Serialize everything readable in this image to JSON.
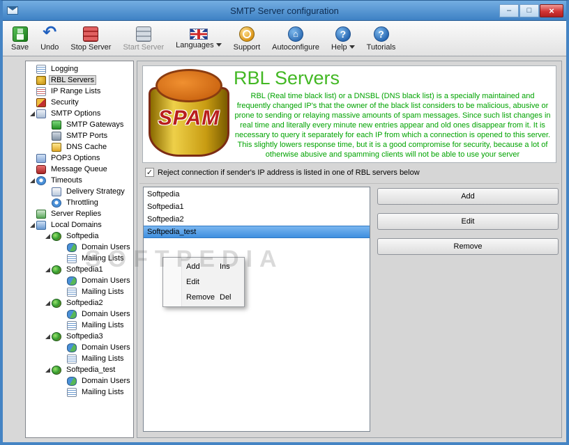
{
  "window": {
    "title": "SMTP Server configuration",
    "controls": {
      "minimize_glyph": "–",
      "maximize_glyph": "□",
      "close_glyph": "×"
    }
  },
  "colors": {
    "titlebar_top": "#74aee2",
    "titlebar_bottom": "#3e81c4",
    "window_border": "#4584c4",
    "close_button_red": "#d23535",
    "header_title_green": "#43b824",
    "description_green": "#00a300",
    "selection_blue": "#3f8fe0"
  },
  "toolbar": {
    "items": [
      {
        "name": "save",
        "label": "Save",
        "icon": "save-icon",
        "enabled": true,
        "dropdown": false
      },
      {
        "name": "undo",
        "label": "Undo",
        "icon": "undo-icon",
        "enabled": true,
        "dropdown": false
      },
      {
        "name": "stop-server",
        "label": "Stop Server",
        "icon": "stop-server-icon",
        "enabled": true,
        "dropdown": false
      },
      {
        "name": "start-server",
        "label": "Start Server",
        "icon": "start-server-icon",
        "enabled": false,
        "dropdown": false
      },
      {
        "name": "languages",
        "label": "Languages",
        "icon": "languages-flag-icon",
        "enabled": true,
        "dropdown": true
      },
      {
        "name": "support",
        "label": "Support",
        "icon": "support-icon",
        "enabled": true,
        "dropdown": false
      },
      {
        "name": "autoconfigure",
        "label": "Autoconfigure",
        "icon": "autoconfigure-icon",
        "enabled": true,
        "dropdown": false
      },
      {
        "name": "help",
        "label": "Help",
        "icon": "help-icon",
        "enabled": true,
        "dropdown": true
      },
      {
        "name": "tutorials",
        "label": "Tutorials",
        "icon": "tutorials-icon",
        "enabled": true,
        "dropdown": false
      }
    ]
  },
  "sidebar": {
    "items": [
      {
        "label": "Logging",
        "level": 0,
        "icon": "logging-icon",
        "expanded": false,
        "selected": false
      },
      {
        "label": "RBL Servers",
        "level": 0,
        "icon": "rbl-servers-icon",
        "expanded": false,
        "selected": true
      },
      {
        "label": "IP Range Lists",
        "level": 0,
        "icon": "ip-range-lists-icon",
        "expanded": false,
        "selected": false
      },
      {
        "label": "Security",
        "level": 0,
        "icon": "security-icon",
        "expanded": false,
        "selected": false
      },
      {
        "label": "SMTP Options",
        "level": 0,
        "icon": "smtp-options-icon",
        "expanded": true,
        "selected": false
      },
      {
        "label": "SMTP Gateways",
        "level": 1,
        "icon": "smtp-gateways-icon",
        "expanded": false,
        "selected": false
      },
      {
        "label": "SMTP Ports",
        "level": 1,
        "icon": "smtp-ports-icon",
        "expanded": false,
        "selected": false
      },
      {
        "label": "DNS Cache",
        "level": 1,
        "icon": "dns-cache-icon",
        "expanded": false,
        "selected": false
      },
      {
        "label": "POP3 Options",
        "level": 0,
        "icon": "pop3-options-icon",
        "expanded": false,
        "selected": false
      },
      {
        "label": "Message Queue",
        "level": 0,
        "icon": "message-queue-icon",
        "expanded": false,
        "selected": false
      },
      {
        "label": "Timeouts",
        "level": 0,
        "icon": "timeouts-icon",
        "expanded": true,
        "selected": false
      },
      {
        "label": "Delivery Strategy",
        "level": 1,
        "icon": "delivery-strategy-icon",
        "expanded": false,
        "selected": false
      },
      {
        "label": "Throttling",
        "level": 1,
        "icon": "throttling-icon",
        "expanded": false,
        "selected": false
      },
      {
        "label": "Server Replies",
        "level": 0,
        "icon": "server-replies-icon",
        "expanded": false,
        "selected": false
      },
      {
        "label": "Local Domains",
        "level": 0,
        "icon": "local-domains-icon",
        "expanded": true,
        "selected": false
      },
      {
        "label": "Softpedia",
        "level": 1,
        "icon": "domain-icon",
        "expanded": true,
        "selected": false
      },
      {
        "label": "Domain Users",
        "level": 2,
        "icon": "domain-users-icon",
        "expanded": false,
        "selected": false
      },
      {
        "label": "Mailing Lists",
        "level": 2,
        "icon": "mailing-lists-icon",
        "expanded": false,
        "selected": false
      },
      {
        "label": "Softpedia1",
        "level": 1,
        "icon": "domain-icon",
        "expanded": true,
        "selected": false
      },
      {
        "label": "Domain Users",
        "level": 2,
        "icon": "domain-users-icon",
        "expanded": false,
        "selected": false
      },
      {
        "label": "Mailing Lists",
        "level": 2,
        "icon": "mailing-lists-icon",
        "expanded": false,
        "selected": false
      },
      {
        "label": "Softpedia2",
        "level": 1,
        "icon": "domain-icon",
        "expanded": true,
        "selected": false
      },
      {
        "label": "Domain Users",
        "level": 2,
        "icon": "domain-users-icon",
        "expanded": false,
        "selected": false
      },
      {
        "label": "Mailing Lists",
        "level": 2,
        "icon": "mailing-lists-icon",
        "expanded": false,
        "selected": false
      },
      {
        "label": "Softpedia3",
        "level": 1,
        "icon": "domain-icon",
        "expanded": true,
        "selected": false
      },
      {
        "label": "Domain Users",
        "level": 2,
        "icon": "domain-users-icon",
        "expanded": false,
        "selected": false
      },
      {
        "label": "Mailing Lists",
        "level": 2,
        "icon": "mailing-lists-icon",
        "expanded": false,
        "selected": false
      },
      {
        "label": "Softpedia_test",
        "level": 1,
        "icon": "domain-icon",
        "expanded": true,
        "selected": false
      },
      {
        "label": "Domain Users",
        "level": 2,
        "icon": "domain-users-icon",
        "expanded": false,
        "selected": false
      },
      {
        "label": "Mailing Lists",
        "level": 2,
        "icon": "mailing-lists-icon",
        "expanded": false,
        "selected": false
      }
    ]
  },
  "main": {
    "title": "RBL Servers",
    "logo_text": "SPAM",
    "description": "RBL (Real time black list) or a DNSBL (DNS black list) is a specially maintained and frequently changed IP's that the owner of the black list considers to be malicious, abusive or prone to sending or relaying massive amounts of spam messages. Since such list changes in real time and literally every minute new entries appear and old ones disappear from it. It is necessary to query it separately for each IP from which a connection is opened to this server. This slightly lowers response time, but it is a good compromise for security, because a lot of otherwise abusive and spamming clients will not be able to use your server",
    "checkbox": {
      "label": "Reject connection if sender's IP address is listed in one of RBL servers below",
      "checked": true
    },
    "rbl_list": {
      "items": [
        "Softpedia",
        "Softpedia1",
        "Softpedia2",
        "Softpedia_test"
      ],
      "selected_index": 3
    },
    "buttons": [
      {
        "label": "Add"
      },
      {
        "label": "Edit"
      },
      {
        "label": "Remove"
      }
    ],
    "context_menu": {
      "items": [
        {
          "label": "Add",
          "shortcut": "Ins"
        },
        {
          "label": "Edit",
          "shortcut": ""
        },
        {
          "label": "Remove",
          "shortcut": "Del"
        }
      ]
    }
  },
  "watermark": "SOFTPEDIA"
}
